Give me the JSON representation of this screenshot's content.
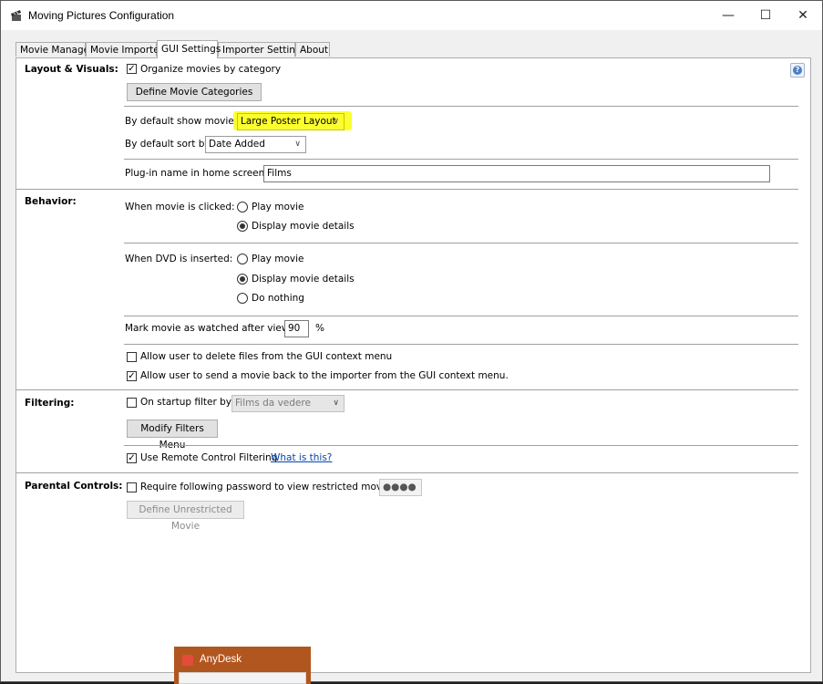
{
  "window": {
    "title": "Moving Pictures Configuration",
    "minimize": "—",
    "maximize": "☐",
    "close": "✕"
  },
  "tabs": [
    "Movie Manager",
    "Movie Importer",
    "GUI Settings",
    "Importer Settings",
    "About"
  ],
  "active_tab": "GUI Settings",
  "layout": {
    "section_label": "Layout & Visuals:",
    "organize_by_category": {
      "label": "Organize movies by category",
      "checked": true
    },
    "define_categories_button": "Define Movie Categories",
    "default_show_label": "By default show movies in",
    "default_show_value": "Large Poster Layout",
    "default_sort_label": "By default sort by",
    "default_sort_value": "Date Added",
    "plugin_name_label": "Plug-in name in home screen:",
    "plugin_name_value": "Films"
  },
  "behavior": {
    "section_label": "Behavior:",
    "movie_clicked_label": "When movie is clicked:",
    "movie_clicked_options": [
      "Play movie",
      "Display movie details"
    ],
    "movie_clicked_selected": "Display movie details",
    "dvd_inserted_label": "When DVD is inserted:",
    "dvd_inserted_options": [
      "Play movie",
      "Display movie details",
      "Do nothing"
    ],
    "dvd_inserted_selected": "Display movie details",
    "watched_label": "Mark movie as watched after viewing",
    "watched_value": "90",
    "watched_unit": "%",
    "allow_delete": {
      "label": "Allow user to delete files from the GUI context menu",
      "checked": false
    },
    "allow_send_back": {
      "label": "Allow user to send a movie back to the importer from the GUI context menu.",
      "checked": true
    }
  },
  "filtering": {
    "section_label": "Filtering:",
    "startup_filter": {
      "label": "On startup filter by:",
      "checked": false
    },
    "startup_filter_value": "Films da vedere",
    "modify_filters_button": "Modify Filters Menu",
    "remote_filtering": {
      "label": "Use Remote Control Filtering",
      "checked": true
    },
    "what_is_this_link": "What is this?"
  },
  "parental": {
    "section_label": "Parental Controls:",
    "require_password": {
      "label": "Require following password to view restricted movies:",
      "checked": false
    },
    "password_value": "●●●●",
    "define_unrestricted_button": "Define Unrestricted Movie"
  },
  "help_icon": "?",
  "anydesk": {
    "title": "AnyDesk"
  },
  "colors": {
    "highlight": "#fbff2d",
    "link": "#0645ad",
    "anydesk": "#b2561f"
  }
}
